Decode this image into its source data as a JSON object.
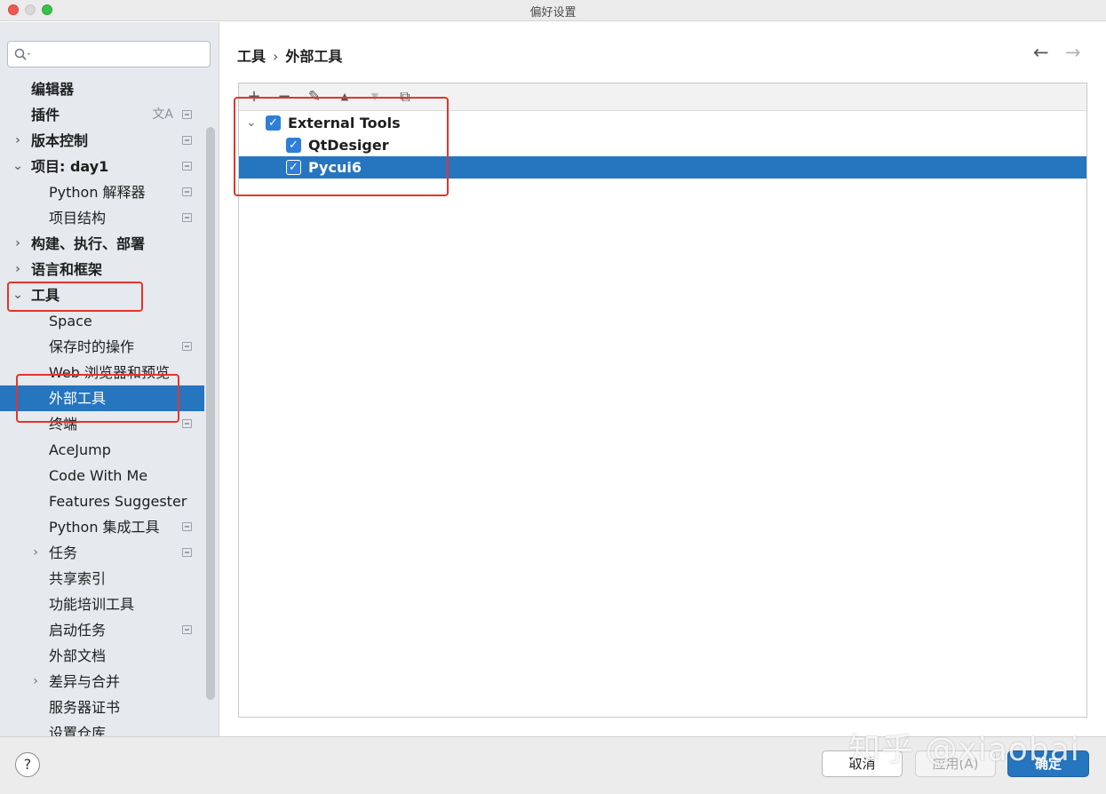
{
  "window": {
    "title": "偏好设置"
  },
  "sidebar": {
    "search": {
      "placeholder": "",
      "value": ""
    },
    "items": [
      {
        "label": "编辑器",
        "level": 0,
        "arrow": "",
        "trail": false
      },
      {
        "label": "插件",
        "level": 0,
        "arrow": "",
        "trail": true,
        "translate_icon": "文A"
      },
      {
        "label": "版本控制",
        "level": 0,
        "arrow": "›",
        "trail": true
      },
      {
        "label": "项目: day1",
        "level": 0,
        "arrow": "⌄",
        "trail": true
      },
      {
        "label": "Python 解释器",
        "level": 1,
        "arrow": "",
        "trail": true
      },
      {
        "label": "项目结构",
        "level": 1,
        "arrow": "",
        "trail": true
      },
      {
        "label": "构建、执行、部署",
        "level": 0,
        "arrow": "›",
        "trail": false
      },
      {
        "label": "语言和框架",
        "level": 0,
        "arrow": "›",
        "trail": false
      },
      {
        "label": "工具",
        "level": 0,
        "arrow": "⌄",
        "trail": false
      },
      {
        "label": "Space",
        "level": 1,
        "arrow": "",
        "trail": false
      },
      {
        "label": "保存时的操作",
        "level": 1,
        "arrow": "",
        "trail": true
      },
      {
        "label": "Web 浏览器和预览",
        "level": 1,
        "arrow": "",
        "trail": false
      },
      {
        "label": "外部工具",
        "level": 1,
        "arrow": "",
        "trail": false,
        "selected": true
      },
      {
        "label": "终端",
        "level": 1,
        "arrow": "",
        "trail": true
      },
      {
        "label": "AceJump",
        "level": 1,
        "arrow": "",
        "trail": false
      },
      {
        "label": "Code With Me",
        "level": 1,
        "arrow": "",
        "trail": false
      },
      {
        "label": "Features Suggester",
        "level": 1,
        "arrow": "",
        "trail": false
      },
      {
        "label": "Python 集成工具",
        "level": 1,
        "arrow": "",
        "trail": true
      },
      {
        "label": "任务",
        "level": 1,
        "arrow": "›",
        "trail": true
      },
      {
        "label": "共享索引",
        "level": 1,
        "arrow": "",
        "trail": false
      },
      {
        "label": "功能培训工具",
        "level": 1,
        "arrow": "",
        "trail": false
      },
      {
        "label": "启动任务",
        "level": 1,
        "arrow": "",
        "trail": true
      },
      {
        "label": "外部文档",
        "level": 1,
        "arrow": "",
        "trail": false
      },
      {
        "label": "差异与合并",
        "level": 1,
        "arrow": "›",
        "trail": false
      },
      {
        "label": "服务器证书",
        "level": 1,
        "arrow": "",
        "trail": false
      },
      {
        "label": "设置仓库",
        "level": 1,
        "arrow": "",
        "trail": false
      }
    ]
  },
  "main": {
    "breadcrumb": {
      "parent": "工具",
      "separator": "›",
      "current": "外部工具"
    },
    "nav": {
      "back": "←",
      "forward": "→"
    },
    "toolbar": {
      "add": "+",
      "remove": "−",
      "edit": "✎",
      "move_up": "▲",
      "move_down": "▼",
      "copy": "⧉"
    },
    "tree": [
      {
        "label": "External Tools",
        "checked": true,
        "level": 0,
        "arrow": "⌄"
      },
      {
        "label": "QtDesiger",
        "checked": true,
        "level": 1
      },
      {
        "label": "Pycui6",
        "checked": true,
        "level": 1,
        "selected": true
      }
    ]
  },
  "footer": {
    "help": "?",
    "cancel": "取消",
    "apply": "应用(A)",
    "ok": "确定"
  },
  "watermark": "知乎 @xiaobai",
  "colors": {
    "selection": "#2675bf",
    "annotation": "#e2352c",
    "checkbox": "#2f7ed8"
  }
}
